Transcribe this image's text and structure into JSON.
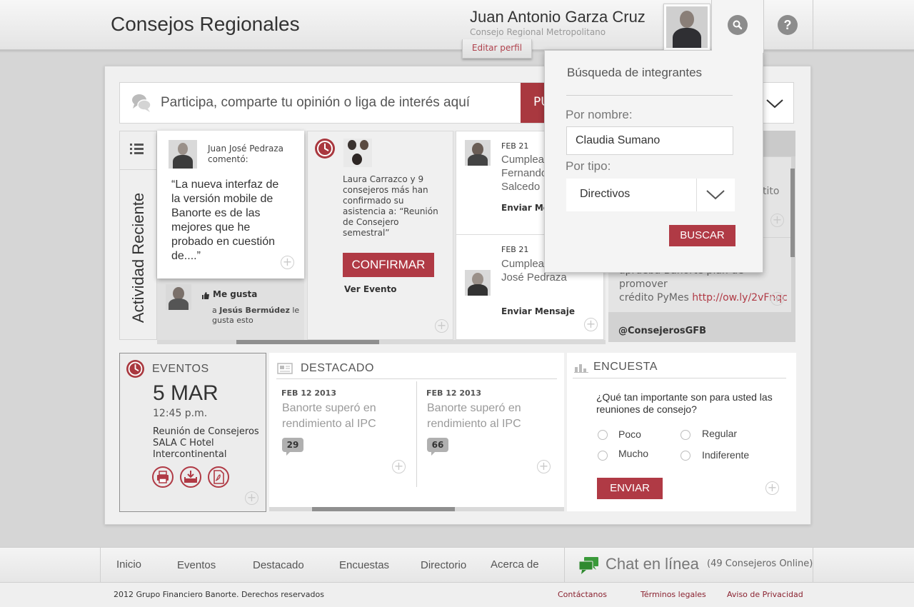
{
  "header": {
    "app_title": "Consejos Regionales",
    "user_name": "Juan Antonio Garza Cruz",
    "user_region": "Consejo Regional Metropolitano",
    "edit_profile": "Editar perfil",
    "help": "?"
  },
  "post": {
    "placeholder": "Participa, comparte tu opinión o liga de interés aquí",
    "button_label": "PU"
  },
  "sidebar": {
    "vertical_label": "Actividad Reciente"
  },
  "feed": {
    "comment": {
      "author": "Juan José Pedraza",
      "action": "comentó:",
      "quote": "“La nueva interfaz de la versión mobile de Banorte es de las mejores que he probado en cuestión de....”"
    },
    "like": {
      "title": "Me gusta",
      "prefix": "a",
      "person": "Jesús Bermúdez",
      "suffix": "le gusta esto"
    },
    "event_card": {
      "text": "Laura Carrazco y 9 consejeros más han confirmado su asistencia a: “Reunión de Consejero semestral”",
      "confirm_label": "CONFIRMAR",
      "link": "Ver Evento"
    },
    "birthdays": [
      {
        "date": "FEB 21",
        "line1": "Cumplea",
        "line2": "Fernando",
        "line3": "Salcedo",
        "action": "Enviar Me"
      },
      {
        "date": "FEB 21",
        "line1": "Cumplea",
        "line2": "José Pedraza",
        "line3": "",
        "action": "Enviar Mensaje"
      }
    ],
    "twitter": {
      "item1_tail": "tito",
      "item2_line1": "aprueba Banorte plan de promover",
      "item2_line2": "crédito PyMes",
      "item2_link": "http://ow.ly/2vFnqc",
      "handle": "@ConsejerosGFB"
    }
  },
  "events": {
    "title": "EVENTOS",
    "date": "5 MAR",
    "time": "12:45 p.m.",
    "desc_line1": "Reunión  de Consejeros",
    "desc_line2": "SALA C Hotel",
    "desc_line3": "Intercontinental"
  },
  "destacado": {
    "title": "DESTACADO",
    "items": [
      {
        "date": "FEB 12 2013",
        "text": "Banorte superó en rendimiento al IPC",
        "comments": "29"
      },
      {
        "date": "FEB 12 2013",
        "text": "Banorte superó en rendimiento al IPC",
        "comments": "66"
      }
    ]
  },
  "encuesta": {
    "title": "ENCUESTA",
    "question": "¿Qué tan importante son para usted las reuniones de consejo?",
    "options": [
      "Poco",
      "Regular",
      "Mucho",
      "Indiferente"
    ],
    "submit": "ENVIAR"
  },
  "search_panel": {
    "title": "Búsqueda de integrantes",
    "name_label": "Por nombre:",
    "name_value": "Claudia Sumano",
    "type_label": "Por tipo:",
    "type_value": "Directivos",
    "submit": "BUSCAR"
  },
  "footer": {
    "nav": [
      "Inicio",
      "Eventos",
      "Destacado",
      "Encuestas",
      "Directorio",
      "Acerca de"
    ],
    "chat_label": "Chat en línea",
    "chat_count": "(49 Consejeros Online)",
    "copyright": "2012 Grupo Financiero Banorte. Derechos reservados",
    "links": [
      "Contáctanos",
      "Términos legales",
      "Aviso de Privacidad"
    ]
  },
  "colors": {
    "accent": "#b03a45",
    "link": "#8a2230",
    "background": "#d6d6d6"
  }
}
